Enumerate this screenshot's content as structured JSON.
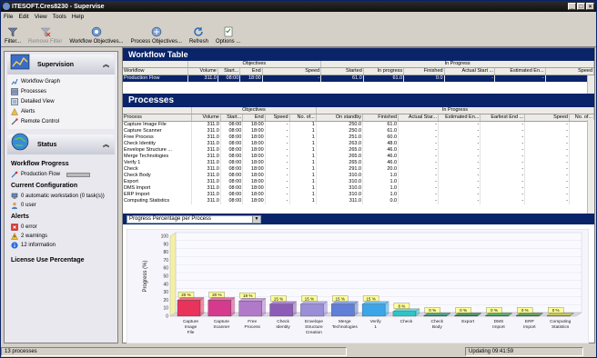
{
  "window": {
    "title": "ITESOFT.Cres8230 - Supervise"
  },
  "menu": [
    "File",
    "Edit",
    "View",
    "Tools",
    "Help"
  ],
  "toolbar": {
    "filter": "Filter...",
    "remove_filter": "Remove Filter",
    "workflow_objectives": "Workflow Objectives...",
    "process_objectives": "Process Objectives...",
    "refresh": "Refresh",
    "options": "Options ..."
  },
  "sidebar": {
    "supervision": {
      "title": "Supervision",
      "items": [
        "Workflow Graph",
        "Processes",
        "Detailed View",
        "Alerts",
        "Remote Control"
      ]
    },
    "status": {
      "title": "Status",
      "workflow_progress_title": "Workflow Progress",
      "production_flow": "Production Flow",
      "current_config_title": "Current Configuration",
      "config_items": [
        "0 automatic workstation (0 task(s))",
        "0 user"
      ],
      "alerts_title": "Alerts",
      "alerts": [
        "0 error",
        "2 warnings",
        "12 information"
      ],
      "license_title": "License Use Percentage"
    }
  },
  "workflow_table": {
    "title": "Workflow Table",
    "group_objectives": "Objectives",
    "group_in_progress": "In Progress",
    "columns": [
      "Workflow",
      "Volume",
      "Start...",
      "End",
      "Speed",
      "Started",
      "In progress",
      "Finished",
      "Actual Start ...",
      "Estimated En...",
      "Speed"
    ],
    "rows": [
      [
        "Production Flow",
        "311.0",
        "08:00",
        "18:00",
        "-",
        "61.0",
        "61.0",
        "0.0",
        "-",
        "-",
        "-"
      ]
    ]
  },
  "processes": {
    "title": "Processes",
    "group_objectives": "Objectives",
    "group_in_progress": "In Progress",
    "columns": [
      "Process",
      "Volume",
      "Start...",
      "End",
      "Speed",
      "No. of...",
      "On standby",
      "Finished",
      "Actual Star...",
      "Estimated En...",
      "Earliest End ...",
      "Speed",
      "No. of..."
    ],
    "rows": [
      [
        "Capture Image File",
        "311.0",
        "08:00",
        "18:00",
        "-",
        "1",
        "250.0",
        "61.0",
        "-",
        "-",
        "-",
        "-",
        "0"
      ],
      [
        "Capture Scanner",
        "311.0",
        "08:00",
        "18:00",
        "-",
        "1",
        "250.0",
        "61.0",
        "-",
        "-",
        "-",
        "-",
        "0"
      ],
      [
        "Free Process",
        "311.0",
        "08:00",
        "18:00",
        "-",
        "1",
        "251.0",
        "60.0",
        "-",
        "-",
        "-",
        "-",
        "0"
      ],
      [
        "Check Identity",
        "311.0",
        "08:00",
        "18:00",
        "-",
        "1",
        "263.0",
        "48.0",
        "-",
        "-",
        "-",
        "-",
        "0"
      ],
      [
        "Envelope Structure ...",
        "311.0",
        "08:00",
        "18:00",
        "-",
        "1",
        "265.0",
        "46.0",
        "-",
        "-",
        "-",
        "-",
        "0"
      ],
      [
        "Merge Technologies",
        "311.0",
        "08:00",
        "18:00",
        "-",
        "1",
        "265.0",
        "46.0",
        "-",
        "-",
        "-",
        "-",
        "0"
      ],
      [
        "Verify 1",
        "311.0",
        "08:00",
        "18:00",
        "-",
        "1",
        "265.0",
        "46.0",
        "-",
        "-",
        "-",
        "-",
        "0"
      ],
      [
        "Check",
        "311.0",
        "08:00",
        "18:00",
        "-",
        "1",
        "291.0",
        "20.0",
        "-",
        "-",
        "-",
        "-",
        "0"
      ],
      [
        "Check Body",
        "311.0",
        "08:00",
        "18:00",
        "-",
        "1",
        "310.0",
        "1.0",
        "-",
        "-",
        "-",
        "-",
        "0"
      ],
      [
        "Export",
        "311.0",
        "08:00",
        "18:00",
        "-",
        "1",
        "310.0",
        "1.0",
        "-",
        "-",
        "-",
        "-",
        "0"
      ],
      [
        "DMS Import",
        "311.0",
        "08:00",
        "18:00",
        "-",
        "1",
        "310.0",
        "1.0",
        "-",
        "-",
        "-",
        "-",
        "0"
      ],
      [
        "ERP Import",
        "311.0",
        "08:00",
        "18:00",
        "-",
        "1",
        "310.0",
        "1.0",
        "-",
        "-",
        "-",
        "-",
        "0"
      ],
      [
        "Computing Statistics",
        "311.0",
        "08:00",
        "18:00",
        "-",
        "1",
        "311.0",
        "0.0",
        "-",
        "-",
        "-",
        "-",
        "0"
      ]
    ]
  },
  "chart_select": {
    "value": "Progress Percentage per Process"
  },
  "chart_data": {
    "type": "bar",
    "categories": [
      "Capture Image File",
      "Capture Scanner",
      "Free Process",
      "Check Identity",
      "Envelope Structure Creation",
      "Merge Technologies",
      "Verify 1",
      "Check",
      "Check Body",
      "Export",
      "DMS Import",
      "ERP Import",
      "Computing Statistics"
    ],
    "values": [
      20,
      20,
      19,
      15,
      15,
      15,
      15,
      6,
      0,
      0,
      0,
      0,
      0
    ],
    "labels": [
      "20 %",
      "20 %",
      "19 %",
      "15 %",
      "15 %",
      "15 %",
      "15 %",
      "6 %",
      "0 %",
      "0 %",
      "0 %",
      "0 %",
      "0 %"
    ],
    "colors": [
      "#e8335a",
      "#d63a8c",
      "#b07ac8",
      "#8c5bb8",
      "#9a8ed8",
      "#5f7fd8",
      "#3aa6e8",
      "#2ec4c8",
      "#1a8a6a",
      "#1e7a3a",
      "#2a9a3a",
      "#3a8a2a",
      "#bdbd30"
    ],
    "yticks": [
      0,
      10,
      20,
      30,
      40,
      50,
      60,
      70,
      80,
      90,
      100
    ],
    "ylabel": "Progress (%)",
    "ylim": [
      0,
      100
    ]
  },
  "statusbar": {
    "left": "13 processes",
    "right": "Updating 09:41:59"
  }
}
